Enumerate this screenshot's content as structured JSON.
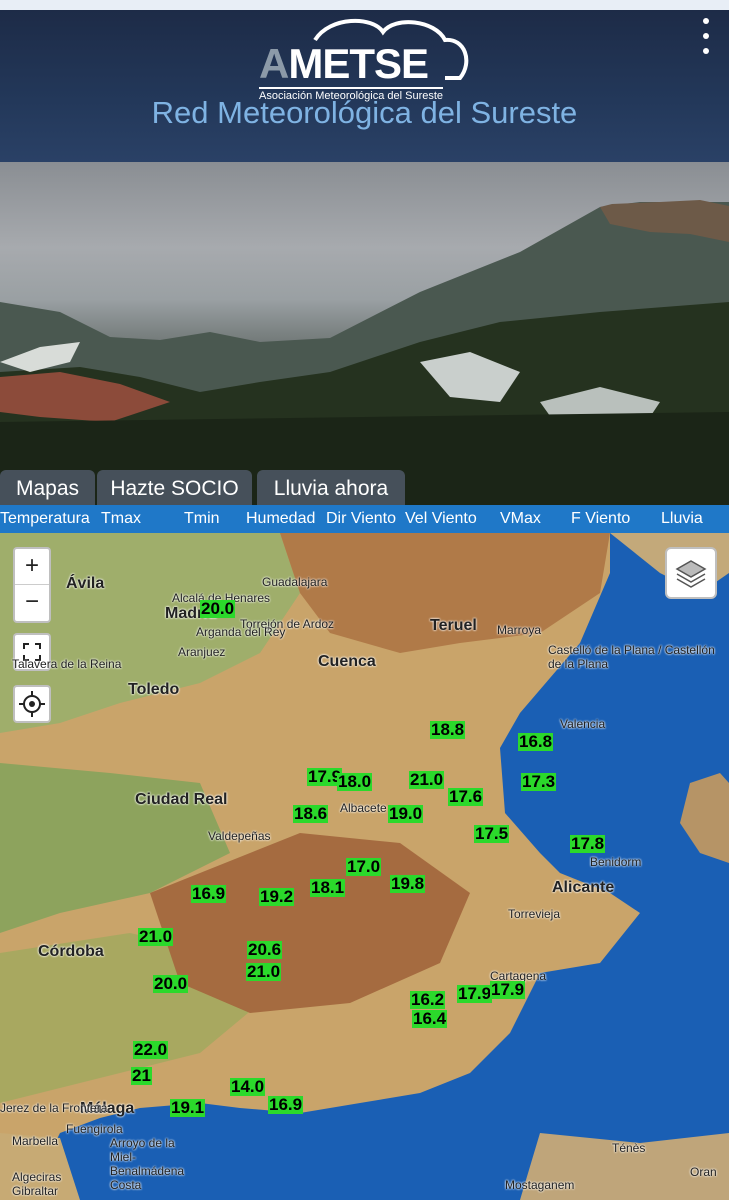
{
  "header": {
    "logo_prefix": "AMETSE",
    "logo_subtitle": "Asociación Meteorológica del Sureste",
    "site_title": "Red Meteorológica del Sureste"
  },
  "tabs": [
    {
      "label": "Mapas"
    },
    {
      "label": "Hazte SOCIO"
    },
    {
      "label": "Lluvia ahora"
    }
  ],
  "variables": [
    "Temperatura",
    "Tmax",
    "Tmin",
    "Humedad",
    "Dir Viento",
    "Vel Viento",
    "VMax",
    "F Viento",
    "Lluvia"
  ],
  "map": {
    "zoom_in": "+",
    "zoom_out": "−",
    "places": [
      "Ávila",
      "Madrid",
      "Torrejón de Ardoz",
      "Arganda del Rey",
      "Aranjuez",
      "Alcalá de Henares",
      "Guadalajara",
      "Teruel",
      "Marroya",
      "Cuenca",
      "Toledo",
      "Talavera de la Reina",
      "Ciudad Real",
      "Valdepeñas",
      "Castelló de la Plana / Castellón de la Plana",
      "Valencia",
      "Albacete",
      "Alicante",
      "Benidorm",
      "Córdoba",
      "Málaga",
      "Fuengirola",
      "Marbella",
      "Algeciras",
      "Gibraltar",
      "Jerez de la Frontera",
      "Arroyo de la Miel-Benalmádena Costa",
      "Torrevieja",
      "Cartagena",
      "Mostaganem",
      "Ténès",
      "Oran"
    ],
    "temperatures": [
      "20.0",
      "18.8",
      "16.8",
      "17.9",
      "18.0",
      "21.0",
      "19.0",
      "18.6",
      "17.6",
      "17.3",
      "19.8",
      "17.5",
      "17.8",
      "16.9",
      "21.0",
      "19.2",
      "20.6",
      "21.0",
      "17.0",
      "16.2",
      "17.9",
      "22.0",
      "21",
      "14.0",
      "16.9",
      "20.0",
      "17.9",
      "18.1",
      "19.1",
      "16.4"
    ]
  }
}
